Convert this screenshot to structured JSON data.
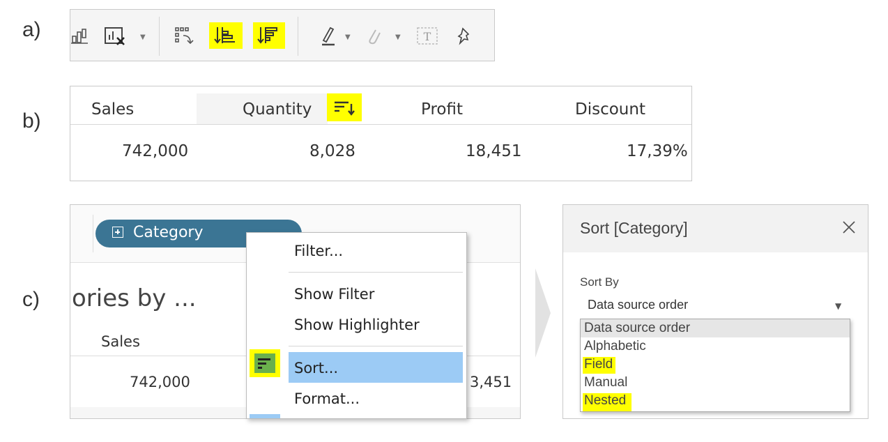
{
  "labels": {
    "a": "a)",
    "b": "b)",
    "c": "c)"
  },
  "toolbar": {
    "highlight_color": "#ffff00",
    "icons": [
      "show-data-icon",
      "clear-sheet-icon",
      "swap-icon",
      "sort-ascending-icon",
      "sort-descending-icon",
      "highlight-icon",
      "annotate-icon",
      "label-icon",
      "pin-icon"
    ]
  },
  "table": {
    "headers": [
      "Sales",
      "Quantity",
      "Profit",
      "Discount"
    ],
    "values": [
      "742,000",
      "8,028",
      "18,451",
      "17,39%"
    ]
  },
  "view": {
    "pill_label": "Category",
    "title_fragment": "ories by ...",
    "col_header": "Sales",
    "value": "742,000",
    "partial_value": "3,451",
    "pill_color": "#3b7594"
  },
  "context_menu": {
    "filter": "Filter...",
    "show_filter": "Show Filter",
    "show_highlighter": "Show Highlighter",
    "sort": "Sort...",
    "format": "Format...",
    "selected_color": "#9ccbf5",
    "sort_icon_bg": "#6ab04c"
  },
  "sort_dialog": {
    "title": "Sort [Category]",
    "sort_by_label": "Sort By",
    "selected": "Data source order",
    "options": [
      "Data source order",
      "Alphabetic",
      "Field",
      "Manual",
      "Nested"
    ]
  }
}
